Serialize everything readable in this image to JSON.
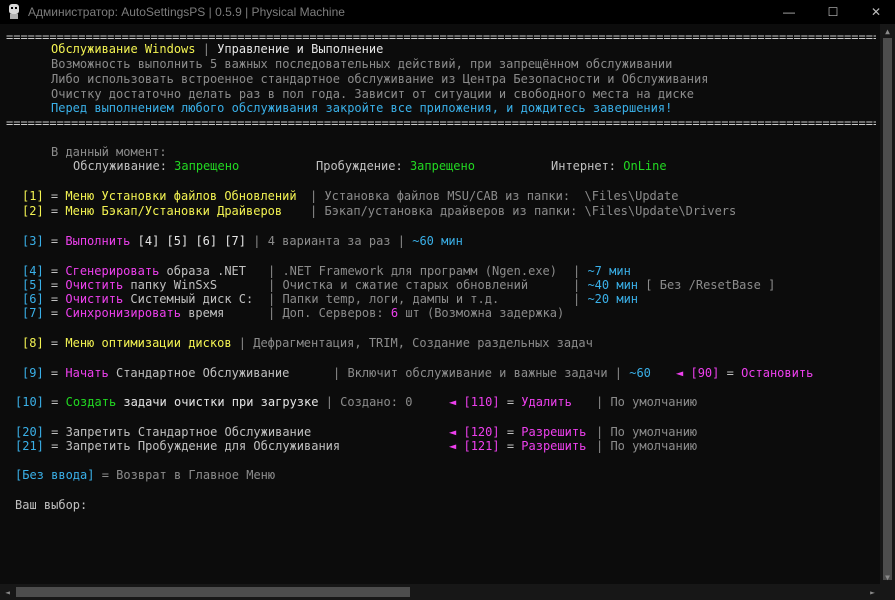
{
  "window": {
    "title": "Администратор: AutoSettingsPS | 0.5.9 | Physical Machine",
    "minimize_glyph": "—",
    "maximize_glyph": "☐",
    "close_glyph": "✕",
    "icon": "app-icon"
  },
  "separator": "=============================================================================================================================",
  "header": {
    "title": "Обслуживание Windows",
    "title_sep": " | ",
    "subtitle": "Управление и Выполнение",
    "line1": "Возможность выполнить 5 важных последовательных действий, при запрещённом обслуживании",
    "line2": "Либо использовать встроенное стандартное обслуживание из Центра Безопасности и Обслуживания",
    "line3": "Очистку достаточно делать раз в пол года. Зависит от ситуации и свободного места на диске",
    "warning": "Перед выполнением любого обслуживания закройте все приложения, и дождитесь завершения!"
  },
  "status": {
    "caption": "В данный момент:",
    "maintenance_label": "Обслуживание",
    "maintenance_value": "Запрещено",
    "wake_label": "Пробуждение",
    "wake_value": "Запрещено",
    "internet_label": "Интернет",
    "internet_value": "OnLine"
  },
  "menu": {
    "m1": {
      "key": "[1]",
      "eq": " = ",
      "label": "Меню Установки файлов Обновлений",
      "desc": "Установка файлов MSU/CAB из папки:  \\Files\\Update"
    },
    "m2": {
      "key": "[2]",
      "eq": " = ",
      "label": "Меню Бэкап/Установки Драйверов",
      "desc": "Бэкап/установка драйверов из папки: \\Files\\Update\\Drivers"
    },
    "m3": {
      "key": "[3]",
      "eq": " = ",
      "verb": "Выполнить",
      "args": "[4] [5] [6] [7]",
      "desc": "4 варианта за раз",
      "time": "~60 мин"
    },
    "m4": {
      "key": "[4]",
      "eq": " = ",
      "verb": "Сгенерировать",
      "rest": "образа .NET",
      "desc": ".NET Framework для программ (Ngen.exe)",
      "time": "~7 мин"
    },
    "m5": {
      "key": "[5]",
      "eq": " = ",
      "verb": "Очистить",
      "rest": "папку WinSxS",
      "desc": "Очистка и сжатие старых обновлений",
      "time": "~40 мин",
      "extra": "[ Без /ResetBase ]"
    },
    "m6": {
      "key": "[6]",
      "eq": " = ",
      "verb": "Очистить",
      "rest": "Системный диск C:",
      "desc": "Папки temp, логи, дампы и т.д.",
      "time": "~20 мин"
    },
    "m7": {
      "key": "[7]",
      "eq": " = ",
      "verb": "Синхронизировать",
      "rest": "время",
      "desc_a": "Доп. Серверов:",
      "desc_n": "6",
      "desc_b": "шт (Возможна задержка)"
    },
    "m8": {
      "key": "[8]",
      "eq": " = ",
      "label": "Меню оптимизации дисков",
      "desc": "Дефрагментация, TRIM, Создание раздельных задач"
    },
    "m9": {
      "key": "[9]",
      "eq": " = ",
      "verb": "Начать",
      "rest": "Стандартное Обслуживание",
      "desc": "Включит обслуживание и важные задачи",
      "time": "~60",
      "arrow": "◄",
      "alt_key": "[90]",
      "alt_label": "Остановить"
    },
    "m10": {
      "key": "[10]",
      "eq": " = ",
      "verb": "Создать",
      "rest": "задачи очистки при загрузке",
      "desc": "Создано: 0",
      "arrow": "◄",
      "alt_key": "[110]",
      "alt_label": "Удалить",
      "default": "По умолчанию"
    },
    "m20": {
      "key": "[20]",
      "eq": " = ",
      "label": "Запретить Стандартное Обслуживание",
      "arrow": "◄",
      "alt_key": "[120]",
      "alt_label": "Разрешить",
      "default": "По умолчанию"
    },
    "m21": {
      "key": "[21]",
      "eq": " = ",
      "label": "Запретить Пробуждение для Обслуживания",
      "arrow": "◄",
      "alt_key": "[121]",
      "alt_label": "Разрешить",
      "default": "По умолчанию"
    },
    "back": {
      "key": "[Без ввода]",
      "eq": " = ",
      "label": "Возврат в Главное Меню"
    }
  },
  "prompt": "Ваш выбор:",
  "colors": {
    "background": "#0c0c0c",
    "yellow": "#f3f352",
    "cyan": "#3ab0e8",
    "green": "#22d922",
    "magenta": "#ee40ee",
    "gray": "#8c8c8c"
  }
}
